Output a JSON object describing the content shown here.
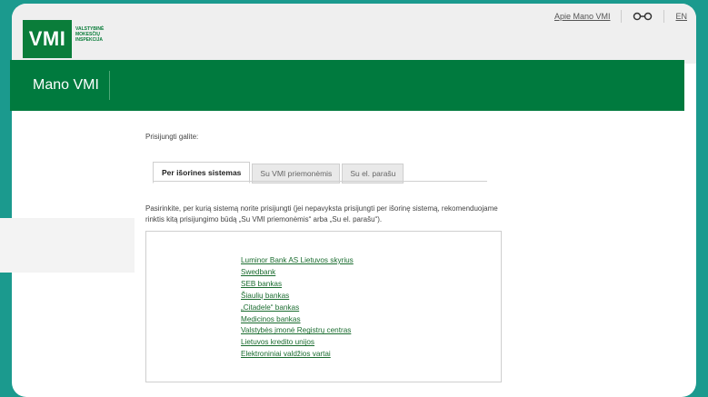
{
  "header": {
    "logo_text": "VMI",
    "logo_subtitle_lines": [
      "VALSTYBINĖ",
      "MOKESČIŲ",
      "INSPEKCIJA"
    ],
    "links": {
      "about": "Apie Mano VMI",
      "accessibility_icon": "glasses-icon",
      "language": "EN"
    }
  },
  "banner": {
    "title": "Mano VMI"
  },
  "main": {
    "intro": "Prisijungti galite:",
    "tabs": [
      {
        "label": "Per išorines sistemas",
        "active": true
      },
      {
        "label": "Su VMI priemonėmis",
        "active": false
      },
      {
        "label": "Su el. parašu",
        "active": false
      }
    ],
    "description": "Pasirinkite, per kurią sistemą norite prisijungti (jei nepavyksta prisijungti per išorinę sistemą, rekomenduojame rinktis kitą prisijungimo būdą „Su VMI priemonėmis“ arba „Su el. parašu“).",
    "banks": [
      "Luminor Bank AS Lietuvos skyrius",
      "Swedbank",
      "SEB bankas",
      "Šiaulių bankas",
      "„Citadele“ bankas",
      "Medicinos bankas",
      "Valstybės įmonė Registrų centras",
      "Lietuvos kredito unijos",
      "Elektroniniai valdžios vartai"
    ]
  },
  "colors": {
    "accent_green": "#007a3e",
    "frame_background": "#1b9a8e",
    "link_green": "#1a6c2f"
  }
}
